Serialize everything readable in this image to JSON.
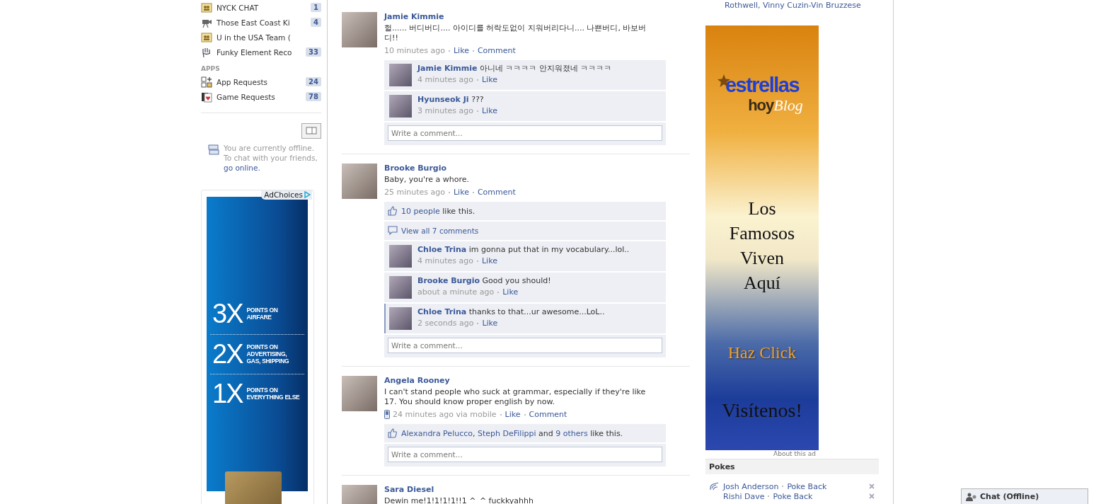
{
  "left_sidebar": {
    "groups": [
      {
        "kind": "group",
        "name": "NYCK CHAT",
        "count": "1"
      },
      {
        "kind": "camera",
        "name": "Those East Coast Ki",
        "count": "4"
      },
      {
        "kind": "group",
        "name": "U in the USA Team ("
      },
      {
        "kind": "hand",
        "name": "Funky Element Reco",
        "count": "33"
      }
    ],
    "apps_heading": "APPS",
    "apps": [
      {
        "kind": "apps",
        "name": "App Requests",
        "count": "24"
      },
      {
        "kind": "cards",
        "name": "Game Requests",
        "count": "78"
      }
    ],
    "chat_status": {
      "text": "You are currently offline. To chat with your friends,",
      "link": "go online."
    },
    "ad": {
      "adchoices": "AdChoices",
      "offers": [
        {
          "multiplier": "3X",
          "lines": [
            "POINTS ON",
            "AIRFARE"
          ]
        },
        {
          "multiplier": "2X",
          "lines": [
            "POINTS ON",
            "ADVERTISING,",
            "GAS, SHIPPING"
          ]
        },
        {
          "multiplier": "1X",
          "lines": [
            "POINTS ON",
            "EVERYTHING ELSE"
          ]
        }
      ]
    }
  },
  "feed": {
    "posts": [
      {
        "author": "Jamie Kimmie",
        "text": "헐...... 버디버디.... 아이디를 허락도없이 지워버리다니.... 나쁜버디, 바보버디!!",
        "time": "10 minutes ago",
        "mobile": false,
        "actions": [
          "Like",
          "Comment"
        ],
        "comment_placeholder": "Write a comment...",
        "comments": [
          {
            "author": "Jamie Kimmie",
            "text": "아니네 ㅋㅋㅋㅋ 안지워졌네 ㅋㅋㅋㅋ",
            "time": "4 minutes ago",
            "action": "Like",
            "highlighted": false
          },
          {
            "author": "Hyunseok Ji",
            "text": "???",
            "time": "3 minutes ago",
            "action": "Like",
            "highlighted": false
          }
        ]
      },
      {
        "author": "Brooke Burgio",
        "text": "Baby, you're a whore.",
        "time": "25 minutes ago",
        "mobile": false,
        "actions": [
          "Like",
          "Comment"
        ],
        "comment_placeholder": "Write a comment...",
        "likes": [
          {
            "text": "10 people",
            "link": true
          },
          {
            "text": " like this.",
            "link": false
          }
        ],
        "view_all": "View all 7 comments",
        "comments": [
          {
            "author": "Chloe Trina",
            "text": "im gonna put that in my vocabulary...lol..",
            "time": "4 minutes ago",
            "action": "Like",
            "highlighted": false
          },
          {
            "author": "Brooke Burgio",
            "text": "Good you should!",
            "time": "about a minute ago",
            "action": "Like",
            "highlighted": false
          },
          {
            "author": "Chloe Trina",
            "text": "thanks to that...ur awesome...LoL..",
            "time": "2 seconds ago",
            "action": "Like",
            "highlighted": true
          }
        ]
      },
      {
        "author": "Angela Rooney",
        "text": "I can't stand people who suck at grammar, especially if they're like 17. You should know proper english by now.",
        "time": "24 minutes ago via mobile",
        "mobile": true,
        "actions": [
          "Like",
          "Comment"
        ],
        "comment_placeholder": "Write a comment...",
        "likes": [
          {
            "text": "Alexandra Pelucco",
            "link": true
          },
          {
            "text": ", ",
            "link": false
          },
          {
            "text": "Steph DeFilippi",
            "link": true
          },
          {
            "text": " and ",
            "link": false
          },
          {
            "text": "9 others",
            "link": true
          },
          {
            "text": " like this.",
            "link": false
          }
        ]
      },
      {
        "author": "Sara Diesel",
        "text": "Dewin me!1!1!1!1!!1 ^_^ fuckkyahhh"
      }
    ]
  },
  "right_column": {
    "friends_tail": "Rothwell, Vinny Cuzin-Vin Bruzzese",
    "ad": {
      "logo_main": "estrellas",
      "logo_sub": "hoy",
      "logo_script": "Blog",
      "headline": "Los Famosos Viven Aquí",
      "cta": "Haz Click",
      "closing": "Visítenos!",
      "about": "About this ad"
    },
    "pokes": {
      "title": "Pokes",
      "items": [
        {
          "name": "Josh Anderson",
          "action": "Poke Back"
        },
        {
          "name": "Rishi Dave",
          "action": "Poke Back"
        }
      ]
    }
  },
  "chat_bar": {
    "label": "Chat (Offline)"
  }
}
